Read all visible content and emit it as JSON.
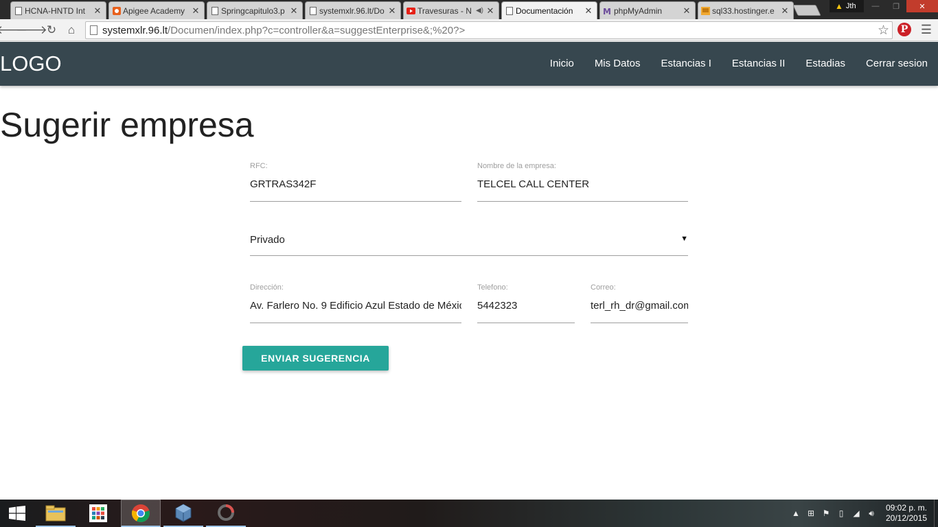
{
  "browser": {
    "tabs": [
      {
        "title": "HCNA-HNTD Int",
        "icon": "page-icon",
        "active": false
      },
      {
        "title": "Apigee Academy",
        "icon": "apigee-icon",
        "active": false
      },
      {
        "title": "Springcapitulo3.p",
        "icon": "page-icon",
        "active": false
      },
      {
        "title": "systemxlr.96.lt/Do",
        "icon": "page-icon",
        "active": false
      },
      {
        "title": "Travesuras - N",
        "icon": "youtube-icon",
        "active": false
      },
      {
        "title": "Documentación",
        "icon": "page-icon",
        "active": true
      },
      {
        "title": "phpMyAdmin",
        "icon": "phpmyadmin-icon",
        "active": false
      },
      {
        "title": "sql33.hostinger.e",
        "icon": "pma-icon",
        "active": false
      }
    ],
    "profile_name": "Jth",
    "url_host": "systemxlr.96.lt",
    "url_path": "/Documen/index.php?c=controller&a=suggestEnterprise&;%20?>"
  },
  "site": {
    "logo": "LOGO",
    "nav": [
      "Inicio",
      "Mis Datos",
      "Estancias I",
      "Estancias II",
      "Estadias",
      "Cerrar sesion"
    ]
  },
  "page": {
    "title": "Sugerir empresa",
    "form": {
      "rfc_label": "RFC:",
      "rfc_value": "GRTRAS342F",
      "nombre_label": "Nombre de la empresa:",
      "nombre_value": "TELCEL CALL CENTER",
      "tipo_value": "Privado",
      "direccion_label": "Dirección:",
      "direccion_value": "Av. Farlero No. 9 Edificio Azul Estado de Méxic",
      "telefono_label": "Telefono:",
      "telefono_value": "5442323",
      "correo_label": "Correo:",
      "correo_value": "terl_rh_dr@gmail.com",
      "submit_label": "ENVIAR SUGERENCIA"
    }
  },
  "taskbar": {
    "time": "09:02 p. m.",
    "date": "20/12/2015"
  },
  "colors": {
    "nav_bg": "#37474f",
    "accent": "#26a69a"
  }
}
